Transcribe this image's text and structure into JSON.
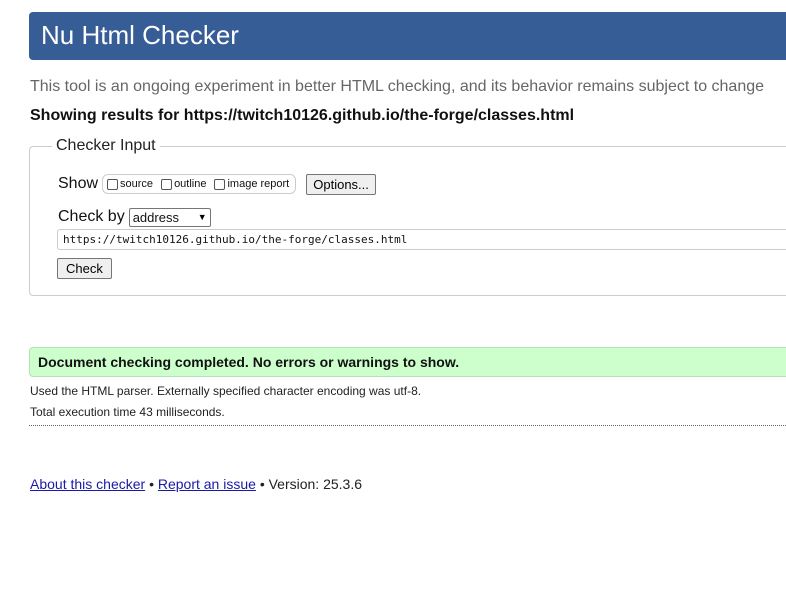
{
  "header": {
    "title": "Nu Html Checker",
    "bg_color": "#365d95"
  },
  "tagline": "This tool is an ongoing experiment in better HTML checking, and its behavior remains subject to change",
  "results_for": "Showing results for https://twitch10126.github.io/the-forge/classes.html",
  "checker_input": {
    "legend": "Checker Input",
    "show_label": "Show",
    "checkboxes": [
      {
        "label": "source",
        "checked": false
      },
      {
        "label": "outline",
        "checked": false
      },
      {
        "label": "image report",
        "checked": false
      }
    ],
    "options_label": "Options...",
    "check_by_label": "Check by",
    "check_by_value": "address",
    "url_value": "https://twitch10126.github.io/the-forge/classes.html",
    "check_button": "Check"
  },
  "result": {
    "message": "Document checking completed. No errors or warnings to show.",
    "bg_color": "#ccffcc",
    "parser_info": "Used the HTML parser. Externally specified character encoding was utf-8.",
    "execution_time": "Total execution time 43 milliseconds."
  },
  "footer": {
    "about_link": "About this checker",
    "separator": "•",
    "report_link": "Report an issue",
    "version": "Version: 25.3.6"
  }
}
